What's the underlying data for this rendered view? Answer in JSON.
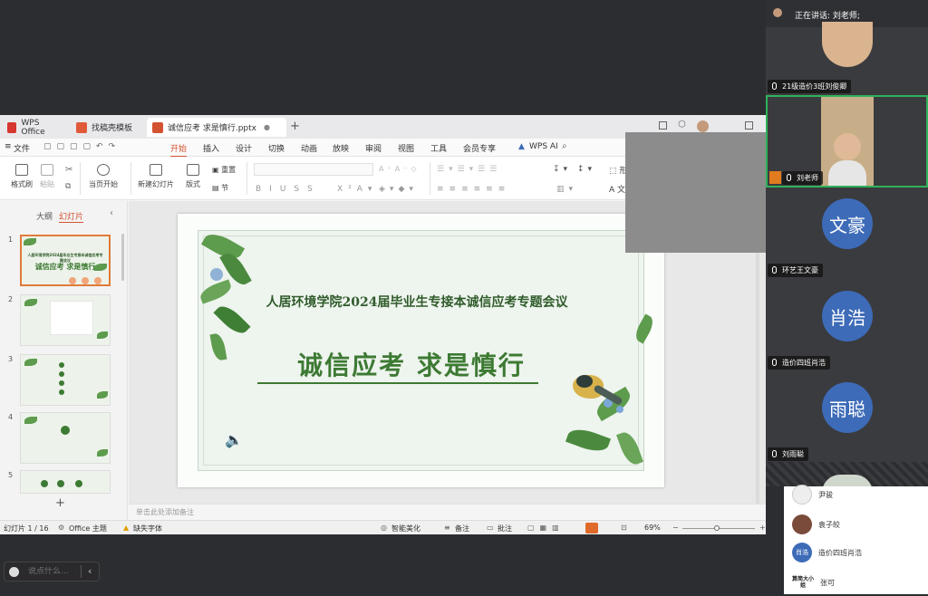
{
  "tabs": [
    {
      "label": "WPS Office",
      "color": "#d7372f"
    },
    {
      "label": "找稿壳模板",
      "color": "#e05a3a"
    },
    {
      "label": "诚信应考 求是慎行.pptx",
      "color": "#d35230"
    }
  ],
  "menus": [
    "文件",
    "开始",
    "插入",
    "设计",
    "切换",
    "动画",
    "放映",
    "审阅",
    "视图",
    "工具",
    "会员专享",
    "WPS AI"
  ],
  "active_menu": "开始",
  "ribbon": {
    "format_painter": "格式刷",
    "paste": "粘贴",
    "play_from_current": "当页开始",
    "new_slide": "新建幻灯片",
    "layout": "版式",
    "reset": "重置",
    "section": "节"
  },
  "left_panel": {
    "outline_tab": "大纲",
    "slides_tab": "幻灯片",
    "thumb_numbers": [
      "1",
      "2",
      "3",
      "4",
      "5"
    ],
    "add_label": "+"
  },
  "slide": {
    "subtitle": "人居环境学院2024届毕业生专接本诚信应考专题会议",
    "title": "诚信应考 求是慎行"
  },
  "notes_placeholder": "单击此处添加备注",
  "status": {
    "slide_count": "幻灯片 1 / 16",
    "theme": "Office 主题",
    "missing_font": "缺失字体",
    "smart_beautify": "智能美化",
    "notes": "备注",
    "comments": "批注",
    "zoom": "69%"
  },
  "meeting": {
    "speaking": "正在讲话: 刘老师;",
    "participants": [
      {
        "name": "21级造价3班刘俊卿",
        "avatar": ""
      },
      {
        "name": "刘老师",
        "avatar": ""
      },
      {
        "name": "环艺王文豪",
        "avatar": "文豪"
      },
      {
        "name": "造价四班肖浩",
        "avatar": "肖浩"
      },
      {
        "name": "刘雨聪",
        "avatar": "雨聪"
      }
    ],
    "colors": {
      "accent": "#3d6bb8",
      "active_border": "#2fb35a"
    }
  },
  "chat": {
    "items": [
      {
        "name": "尹骏",
        "avatar": ""
      },
      {
        "name": "袁子皎",
        "avatar": ""
      },
      {
        "name": "造价四班肖浩",
        "avatar": "肖浩"
      },
      {
        "name": "张可",
        "avatar": "算简大小姐"
      }
    ],
    "placeholder": "说点什么..."
  }
}
